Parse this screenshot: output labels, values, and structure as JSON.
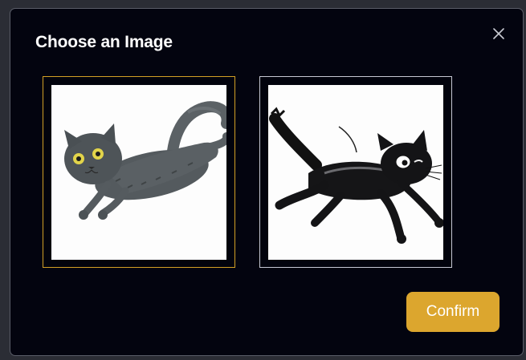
{
  "dialog": {
    "title": "Choose an Image",
    "close_icon": "close-icon",
    "confirm_label": "Confirm"
  },
  "options": [
    {
      "image": "gray-cat-leaping",
      "selected": true
    },
    {
      "image": "black-cat-running",
      "selected": false
    }
  ],
  "colors": {
    "accent": "#dca62e",
    "selected_border": "#d3a025",
    "unselected_border": "#c6c8d4",
    "modal_bg": "#03040f"
  }
}
